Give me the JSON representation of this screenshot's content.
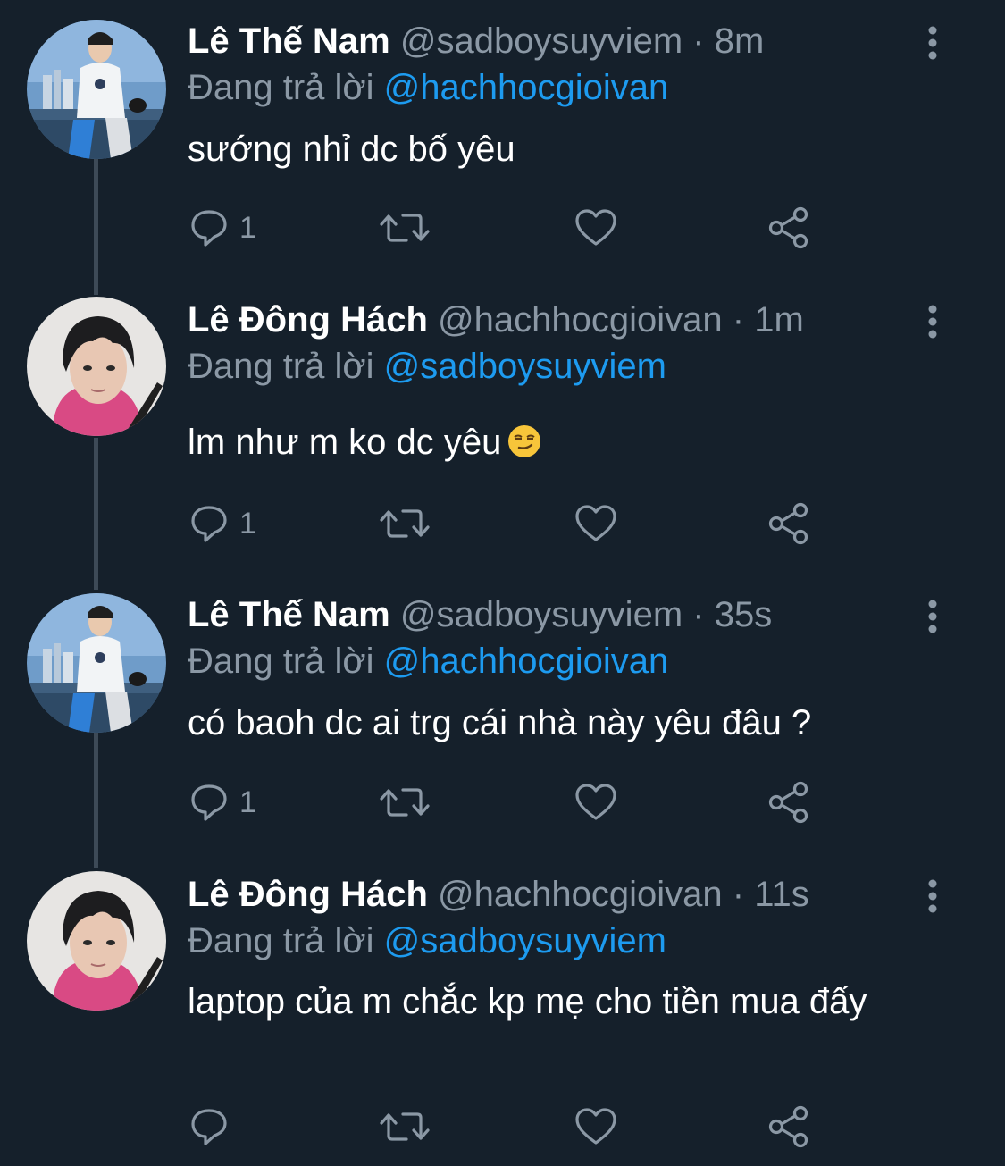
{
  "colors": {
    "background": "#15202b",
    "text_primary": "#ffffff",
    "text_secondary": "#8b98a5",
    "link": "#1d9bf0",
    "thread_line": "#3d4a57"
  },
  "tweets": [
    {
      "name": "Lê Thế Nam",
      "handle": "@sadboysuyviem",
      "separator": "·",
      "time": "8m",
      "reply_prefix": "Đang trả lời",
      "reply_mention": "@hachhocgioivan",
      "text": "sướng nhỉ dc bố yêu",
      "reply_count": "1",
      "avatar_icon": "avatar-photo-man-city-bay"
    },
    {
      "name": "Lê Đông Hách",
      "handle": "@hachhocgioivan",
      "separator": "·",
      "time": "1m",
      "reply_prefix": "Đang trả lời",
      "reply_mention": "@sadboysuyviem",
      "text": "lm như m ko dc yêu",
      "emoji": "smirking-face-emoji",
      "reply_count": "1",
      "avatar_icon": "avatar-photo-boy-pink-hoodie"
    },
    {
      "name": "Lê Thế Nam",
      "handle": "@sadboysuyviem",
      "separator": "·",
      "time": "35s",
      "reply_prefix": "Đang trả lời",
      "reply_mention": "@hachhocgioivan",
      "text": "có baoh dc ai trg cái nhà này yêu đâu ?",
      "reply_count": "1",
      "avatar_icon": "avatar-photo-man-city-bay"
    },
    {
      "name": "Lê Đông Hách",
      "handle": "@hachhocgioivan",
      "separator": "·",
      "time": "11s",
      "reply_prefix": "Đang trả lời",
      "reply_mention": "@sadboysuyviem",
      "text": "laptop của m chắc kp mẹ cho tiền mua đấy",
      "reply_count": "",
      "avatar_icon": "avatar-photo-boy-pink-hoodie"
    }
  ]
}
